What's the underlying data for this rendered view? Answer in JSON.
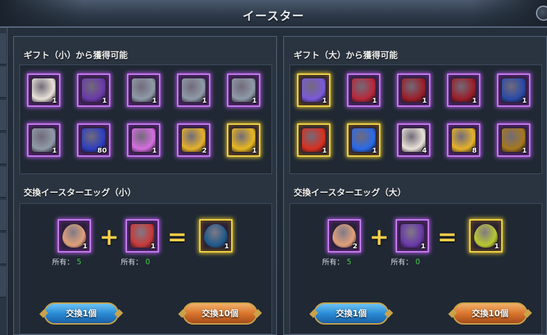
{
  "window": {
    "title": "イースター"
  },
  "left_panel": {
    "gift_title": "ギフト（小）から獲得可能",
    "gifts": [
      {
        "name": "lily-flower",
        "qty": "1",
        "frame": "purple",
        "color": "#e8e2d8"
      },
      {
        "name": "firework-wand",
        "qty": "1",
        "frame": "purple",
        "color": "#6a3aa8"
      },
      {
        "name": "silver-emblem-horse",
        "qty": "1",
        "frame": "purple",
        "color": "#8f9aa8"
      },
      {
        "name": "silver-emblem-knight",
        "qty": "1",
        "frame": "purple",
        "color": "#8f9aa8"
      },
      {
        "name": "silver-emblem-wing",
        "qty": "1",
        "frame": "purple",
        "color": "#8f9aa8"
      },
      {
        "name": "silver-emblem-swirl",
        "qty": "1",
        "frame": "purple",
        "color": "#8f9aa8"
      },
      {
        "name": "blue-crystal",
        "qty": "80",
        "frame": "purple",
        "color": "#2e3fbf"
      },
      {
        "name": "pink-gem",
        "qty": "1",
        "frame": "purple",
        "color": "#d46ee0"
      },
      {
        "name": "gold-coins",
        "qty": "2",
        "frame": "purple",
        "color": "#e6b22c"
      },
      {
        "name": "gold-medal",
        "qty": "1",
        "frame": "gold",
        "color": "#e8b820"
      }
    ],
    "exchange_title": "交換イースターエッグ（小）",
    "recipe": [
      {
        "name": "plain-egg",
        "qty": "1",
        "frame": "purple",
        "color": "#e0a07a"
      },
      {
        "name": "balloon-box",
        "qty": "1",
        "frame": "purple",
        "color": "#c83a3a"
      },
      {
        "name": "blue-easter-egg",
        "qty": "1",
        "frame": "gold",
        "color": "#1f5a8a"
      }
    ],
    "plus": "+",
    "equals": "=",
    "owned_label": "所有：",
    "owned": [
      "5",
      "0"
    ],
    "btn_one": "交換1個",
    "btn_ten": "交換10個"
  },
  "right_panel": {
    "gift_title": "ギフト（大）から獲得可能",
    "gifts": [
      {
        "name": "rainbow-feather",
        "qty": "1",
        "frame": "gold",
        "color": "#7a5ad8"
      },
      {
        "name": "heart-gift-box",
        "qty": "1",
        "frame": "purple",
        "color": "#b8283a"
      },
      {
        "name": "red-gift-box",
        "qty": "1",
        "frame": "purple",
        "color": "#9a1f2a"
      },
      {
        "name": "red-gift-box-2",
        "qty": "1",
        "frame": "purple",
        "color": "#9a1f2a"
      },
      {
        "name": "blue-book",
        "qty": "1",
        "frame": "purple",
        "color": "#2a4aa8"
      },
      {
        "name": "red-crystal",
        "qty": "1",
        "frame": "gold",
        "color": "#d83020"
      },
      {
        "name": "blue-flame",
        "qty": "1",
        "frame": "gold",
        "color": "#2a6ae8"
      },
      {
        "name": "lily-flower",
        "qty": "4",
        "frame": "purple",
        "color": "#e8e2d8"
      },
      {
        "name": "gold-coins",
        "qty": "8",
        "frame": "purple",
        "color": "#e6b22c"
      },
      {
        "name": "bronze-emblem",
        "qty": "1",
        "frame": "purple",
        "color": "#a6781e"
      }
    ],
    "exchange_title": "交換イースターエッグ（大）",
    "recipe": [
      {
        "name": "plain-egg",
        "qty": "2",
        "frame": "purple",
        "color": "#e0a07a"
      },
      {
        "name": "firework-wand",
        "qty": "1",
        "frame": "purple",
        "color": "#6a3aa8"
      },
      {
        "name": "green-easter-egg",
        "qty": "1",
        "frame": "gold",
        "color": "#b8c830"
      }
    ],
    "plus": "+",
    "equals": "=",
    "owned_label": "所有：",
    "owned": [
      "5",
      "0"
    ],
    "btn_one": "交換1個",
    "btn_ten": "交換10個"
  }
}
